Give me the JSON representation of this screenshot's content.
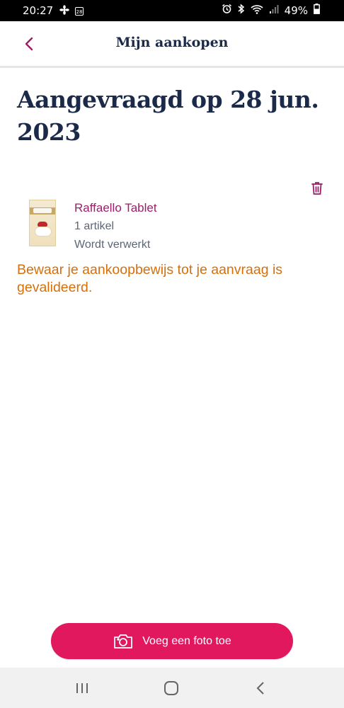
{
  "status_bar": {
    "time": "20:27",
    "calendar_day": "28",
    "battery": "49%"
  },
  "header": {
    "title": "Mijn aankopen",
    "back_icon": "chevron-left-icon"
  },
  "request": {
    "heading": "Aangevraagd op 28 jun. 2023"
  },
  "item": {
    "name": "Raffaello Tablet",
    "quantity": "1 artikel",
    "status": "Wordt verwerkt",
    "delete_icon": "trash-icon"
  },
  "notice": "Bewaar je aankoopbewijs tot je aanvraag is gevalideerd.",
  "actions": {
    "add_photo_label": "Voeg een foto toe",
    "add_photo_icon": "camera-icon"
  },
  "colors": {
    "accent": "#e2185f",
    "title": "#1b2a48",
    "product_name": "#9a1f6a",
    "notice": "#d66f0a"
  }
}
